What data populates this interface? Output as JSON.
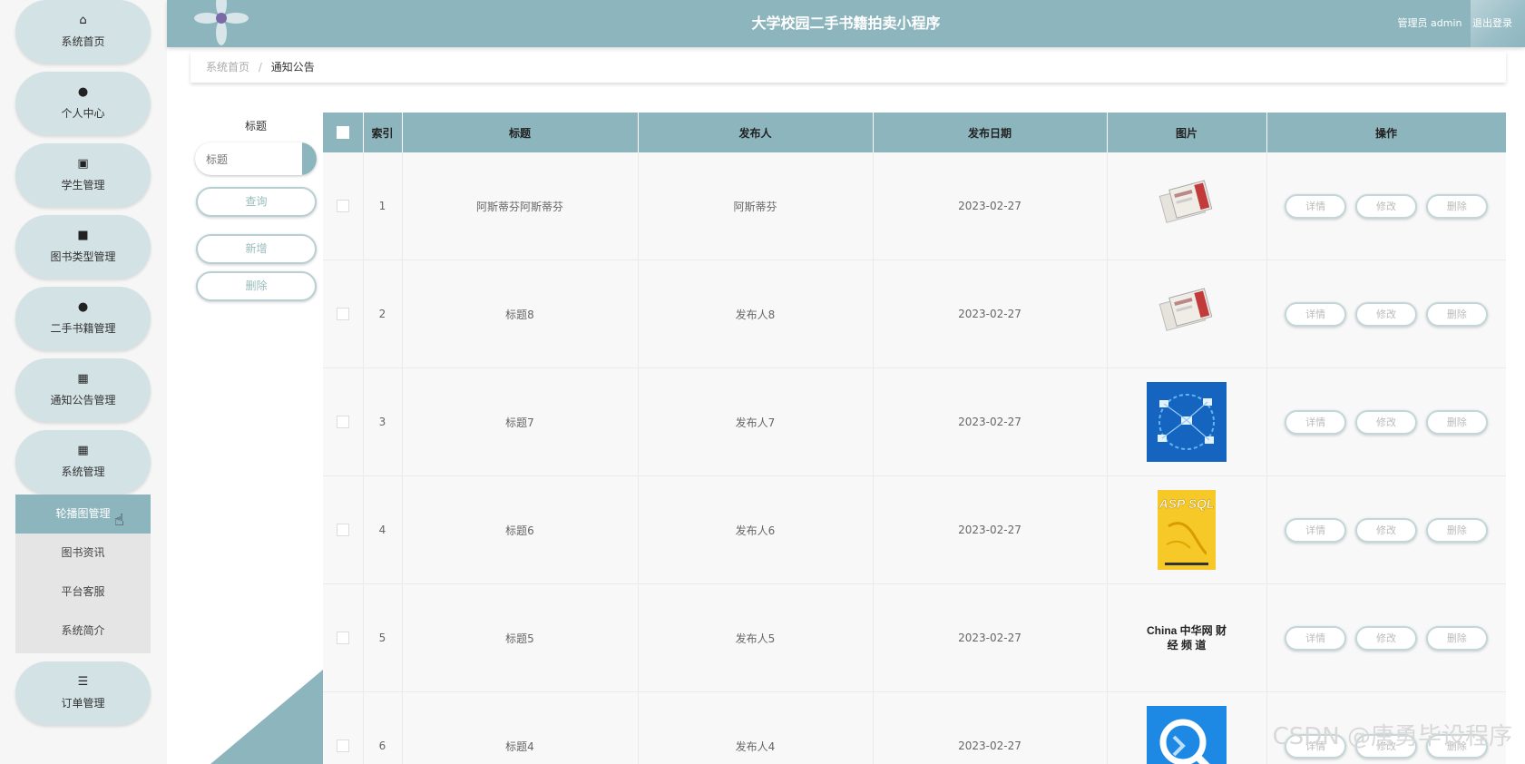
{
  "app": {
    "title": "大学校园二手书籍拍卖小程序",
    "user_label": "管理员 admin",
    "logout_label": "退出登录"
  },
  "sidebar": {
    "items": [
      {
        "label": "系统首页",
        "icon": "home-icon",
        "glyph": "⌂"
      },
      {
        "label": "个人中心",
        "icon": "user-icon",
        "glyph": "●"
      },
      {
        "label": "学生管理",
        "icon": "clipboard-icon",
        "glyph": "▣"
      },
      {
        "label": "图书类型管理",
        "icon": "video-icon",
        "glyph": "■"
      },
      {
        "label": "二手书籍管理",
        "icon": "user-icon",
        "glyph": "●"
      },
      {
        "label": "通知公告管理",
        "icon": "grid-icon",
        "glyph": "▦"
      },
      {
        "label": "系统管理",
        "icon": "grid-icon",
        "glyph": "▦"
      }
    ],
    "sub_items": [
      {
        "label": "轮播图管理",
        "active": true
      },
      {
        "label": "图书资讯",
        "active": false
      },
      {
        "label": "平台客服",
        "active": false
      },
      {
        "label": "系统简介",
        "active": false
      }
    ],
    "last_item": {
      "label": "订单管理",
      "icon": "list-icon",
      "glyph": "☰"
    }
  },
  "breadcrumb": {
    "home": "系统首页",
    "separator": "/",
    "current": "通知公告"
  },
  "search": {
    "label": "标题",
    "placeholder": "标题",
    "query_button": "查询",
    "add_button": "新增",
    "delete_button": "删除"
  },
  "table": {
    "columns": [
      "索引",
      "标题",
      "发布人",
      "发布日期",
      "图片",
      "操作"
    ],
    "action_labels": {
      "detail": "详情",
      "edit": "修改",
      "delete": "删除"
    },
    "rows": [
      {
        "index": "1",
        "title": "阿斯蒂芬阿斯蒂芬",
        "publisher": "阿斯蒂芬",
        "date": "2023-02-27",
        "image": "books-thumbnail"
      },
      {
        "index": "2",
        "title": "标题8",
        "publisher": "发布人8",
        "date": "2023-02-27",
        "image": "books-thumbnail"
      },
      {
        "index": "3",
        "title": "标题7",
        "publisher": "发布人7",
        "date": "2023-02-27",
        "image": "network-thumbnail"
      },
      {
        "index": "4",
        "title": "标题6",
        "publisher": "发布人6",
        "date": "2023-02-27",
        "image": "asp-sql-book-thumbnail",
        "image_text": "ASP SQL"
      },
      {
        "index": "5",
        "title": "标题5",
        "publisher": "发布人5",
        "date": "2023-02-27",
        "image": "china-logo-thumbnail",
        "image_text": "China 中华网 财 经 频 道"
      },
      {
        "index": "6",
        "title": "标题4",
        "publisher": "发布人4",
        "date": "2023-02-27",
        "image": "search-app-thumbnail"
      }
    ]
  },
  "watermark": "CSDN @唐勇毕设程序",
  "colors": {
    "primary": "#8db5bd",
    "pill": "#d3e2e5",
    "sidebar_bg": "#f6f6f6"
  }
}
